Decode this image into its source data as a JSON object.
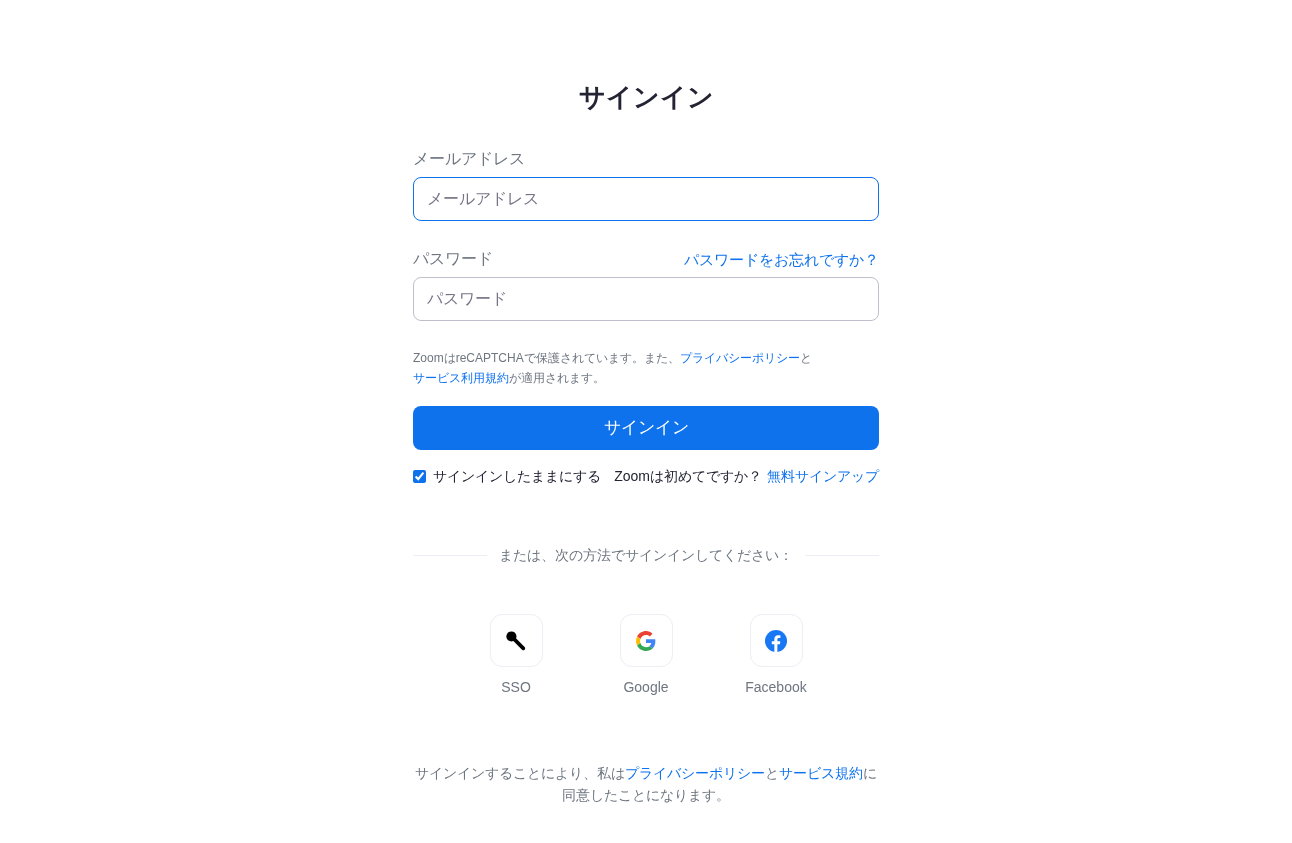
{
  "title": "サインイン",
  "email": {
    "label": "メールアドレス",
    "placeholder": "メールアドレス",
    "focused": true
  },
  "password": {
    "label": "パスワード",
    "placeholder": "パスワード",
    "forgot_link": "パスワードをお忘れですか？",
    "focused": false
  },
  "recaptcha_notice": [
    {
      "kind": "text",
      "text": "ZoomはreCAPTCHAで保護されています。また、"
    },
    {
      "kind": "link",
      "text": "プライバシーポリシー"
    },
    {
      "kind": "text",
      "text": "と"
    },
    {
      "kind": "link",
      "text": "サービス利用規約"
    },
    {
      "kind": "text",
      "text": "が適用されます。"
    }
  ],
  "sign_in_button": "サインイン",
  "stay_signed_in": {
    "label": "サインインしたままにする",
    "checked": true
  },
  "new_user": {
    "question": "Zoomは初めてですか？",
    "link": "無料サインアップ"
  },
  "divider_text": "または、次の方法でサインインしてください：",
  "providers": [
    {
      "kind": "sso",
      "label": "SSO"
    },
    {
      "kind": "google",
      "label": "Google"
    },
    {
      "kind": "facebook",
      "label": "Facebook"
    }
  ],
  "agreement": [
    {
      "kind": "text",
      "text": "サインインすることにより、私は"
    },
    {
      "kind": "link",
      "text": "プライバシーポリシー"
    },
    {
      "kind": "text",
      "text": "と"
    },
    {
      "kind": "link",
      "text": "サービス規約"
    },
    {
      "kind": "text",
      "text": "に同意したことになります。"
    }
  ]
}
